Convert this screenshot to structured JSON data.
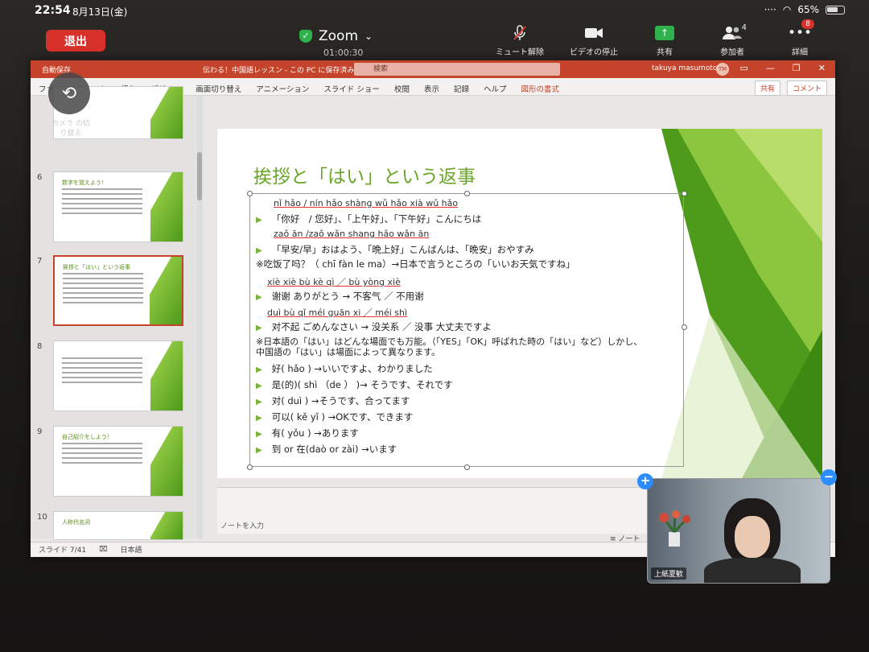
{
  "status": {
    "time": "22:54",
    "date": "8月13日(金)",
    "battery": "65%"
  },
  "zoom": {
    "leave": "退出",
    "title": "Zoom",
    "timer": "01:00:30",
    "controls": [
      {
        "label": "ミュート解除",
        "icon": "mic-off-icon"
      },
      {
        "label": "ビデオの停止",
        "icon": "video-camera-icon"
      },
      {
        "label": "共有",
        "icon": "share-screen-icon"
      },
      {
        "label": "参加者",
        "icon": "participants-icon",
        "count": "4"
      },
      {
        "label": "詳細",
        "icon": "more-icon",
        "badge": "8"
      }
    ]
  },
  "camera": {
    "label": "カメラ の切り替え"
  },
  "ppt": {
    "autosave": "自動保存",
    "doc_title": "伝わる！中国語レッスン - この PC に保存済み",
    "search": "検索",
    "user": "takuya masumoto",
    "user_initials": "TM",
    "tabs": [
      "ファイル",
      "ホーム",
      "挿入",
      "デザイン",
      "画面切り替え",
      "アニメーション",
      "スライド ショー",
      "校閲",
      "表示",
      "記録",
      "ヘルプ",
      "図形の書式"
    ],
    "share_btn": "共有",
    "comment_btn": "コメント",
    "thumbs": [
      {
        "num": "6",
        "title": "数字を覚えよう！"
      },
      {
        "num": "7",
        "title": "挨拶と「はい」という返事"
      },
      {
        "num": "8",
        "title": ""
      },
      {
        "num": "9",
        "title": "自己紹介をしよう！"
      },
      {
        "num": "10",
        "title": "人称代名詞"
      }
    ],
    "notes_placeholder": "ノートを入力",
    "notes_btn": "ノート",
    "statusbar": {
      "slide": "スライド 7/41",
      "lang": "日本語"
    }
  },
  "slide": {
    "title": "挨拶と「はい」という返事",
    "lines": [
      {
        "text": "nǐ hǎo  / nín hǎo   shàng wǔ hǎo   xià wǔ hǎo",
        "kind": "py"
      },
      {
        "text": "「你好　/ 您好」、「上午好」、「下午好」こんにちは",
        "kind": "bullet"
      },
      {
        "text": "zaǒ ān /zaǒ                          wǎn shang hǎo             wǎn ān",
        "kind": "py"
      },
      {
        "text": "「早安/早」おはよう、「晩上好」こんばんは、「晩安」おやすみ",
        "kind": "bullet"
      },
      {
        "text": "※吃饭了吗？（ chī fàn le ma）→日本で言うところの「いいお天気ですね」",
        "kind": "plain"
      },
      {
        "text": "xiè xiè                                       bù kè qì ／ bù yòng xiè",
        "kind": "py"
      },
      {
        "text": "谢谢  ありがとう →   不客气    ／   不用谢",
        "kind": "bullet"
      },
      {
        "text": "duì bù qǐ                                        méi guān xi ／ méi shì",
        "kind": "py"
      },
      {
        "text": "对不起   ごめんなさい →   没关系  ／   没事   大丈夫ですよ",
        "kind": "bullet"
      },
      {
        "text": "※日本語の「はい」はどんな場面でも万能。（「YES」「OK」呼ばれた時の「はい」など）しかし、",
        "kind": "plain"
      },
      {
        "text": "中国語の「はい」は場面によって異なります。",
        "kind": "plain"
      },
      {
        "text": "好( hǎo )   →いいですよ、わかりました",
        "kind": "bullet"
      },
      {
        "text": "是(的)( shì （de ） )→  そうです、それです",
        "kind": "bullet"
      },
      {
        "text": "对( duì ) →そうです、合ってます",
        "kind": "bullet"
      },
      {
        "text": "可以( kě yǐ ) →OKです、できます",
        "kind": "bullet"
      },
      {
        "text": "有( yǒu ) →あります",
        "kind": "bullet"
      },
      {
        "text": "到 or 在(daò or zài) →います",
        "kind": "bullet"
      }
    ]
  },
  "video": {
    "name": "上紙夏歓"
  },
  "colors": {
    "accent_green": "#6aa52a",
    "ppt_red": "#c5432a",
    "zoom_red": "#d8302b",
    "zoom_blue": "#2d8cff"
  }
}
